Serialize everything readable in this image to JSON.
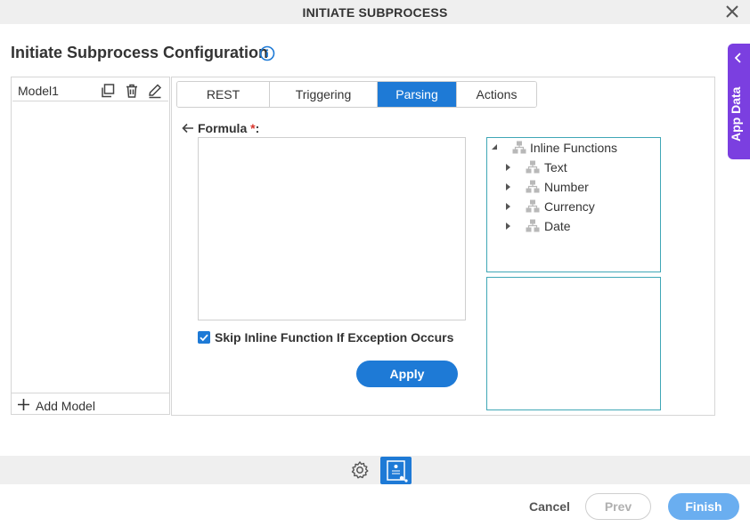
{
  "dialog": {
    "title": "INITIATE SUBPROCESS"
  },
  "page": {
    "heading": "Initiate Subprocess Configuration"
  },
  "app_data": {
    "label": "App Data"
  },
  "models": {
    "items": [
      {
        "name": "Model1"
      }
    ],
    "add_label": "Add Model"
  },
  "tabs": [
    {
      "label": "REST Service",
      "active": false
    },
    {
      "label": "Triggering Event",
      "active": false
    },
    {
      "label": "Parsing",
      "active": true
    },
    {
      "label": "Actions",
      "active": false
    }
  ],
  "formula": {
    "label": "Formula",
    "required_mark": "*",
    "suffix": ":",
    "value": ""
  },
  "skip_option": {
    "label": "Skip Inline Function If Exception Occurs",
    "checked": true
  },
  "apply_label": "Apply",
  "inline_functions": {
    "root_label": "Inline Functions",
    "expanded": true,
    "children": [
      "Text",
      "Number",
      "Currency",
      "Date"
    ]
  },
  "footer": {
    "cancel": "Cancel",
    "prev": "Prev",
    "finish": "Finish"
  },
  "colors": {
    "accent": "#1e7ad6",
    "app_data": "#7b3fe0",
    "tree_border": "#3fa7b6",
    "finish_disabled": "#6aaef0"
  }
}
